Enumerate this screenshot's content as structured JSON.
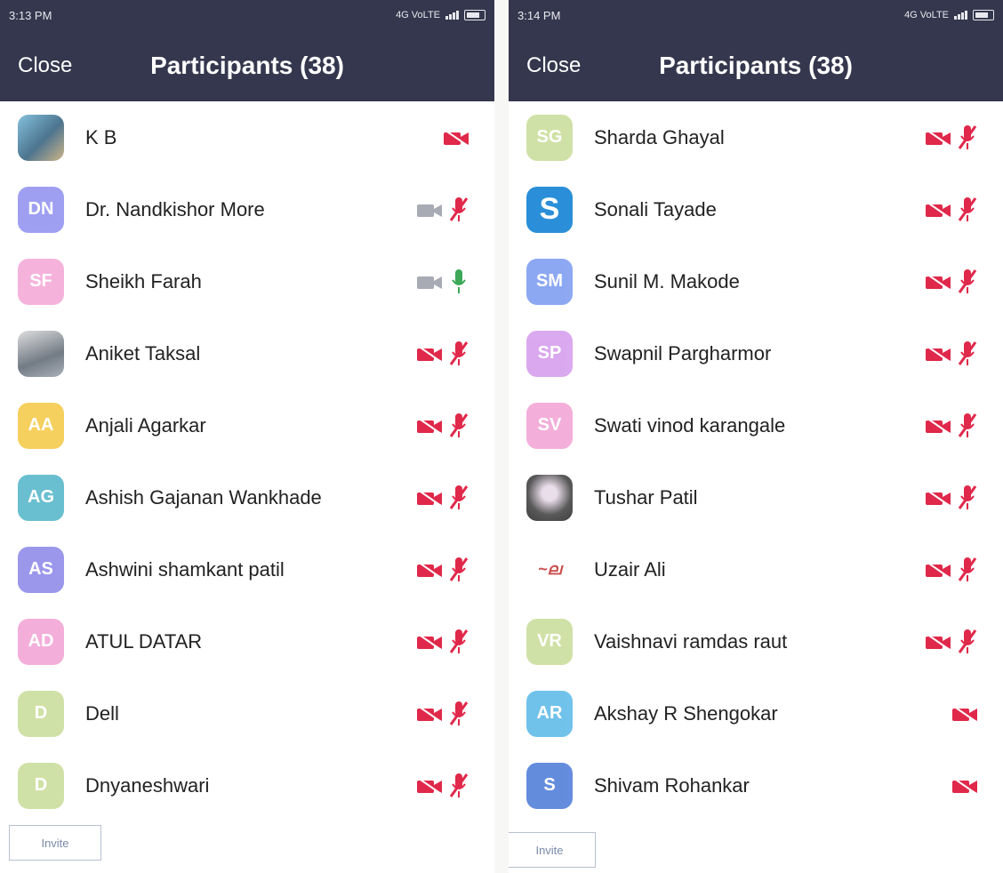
{
  "screens": [
    {
      "status_time": "3:13 PM",
      "status_network": "4G VoLTE",
      "close_label": "Close",
      "title": "Participants (38)",
      "invite_label": "Invite",
      "participants": [
        {
          "name": "K B",
          "initials": "",
          "avatar": "photo",
          "color": "#5a8fc4",
          "video": "off",
          "mic": "none"
        },
        {
          "name": "Dr. Nandkishor More",
          "initials": "DN",
          "avatar": "initials",
          "color": "#8f8ff0",
          "video": "on",
          "mic": "muted"
        },
        {
          "name": "Sheikh Farah",
          "initials": "SF",
          "avatar": "initials",
          "color": "#f4a6d6",
          "video": "on",
          "mic": "active"
        },
        {
          "name": "Aniket Taksal",
          "initials": "",
          "avatar": "photo2",
          "color": "#7a8290",
          "video": "off",
          "mic": "muted"
        },
        {
          "name": "Anjali Agarkar",
          "initials": "AA",
          "avatar": "initials",
          "color": "#f5c842",
          "video": "off",
          "mic": "muted"
        },
        {
          "name": "Ashish Gajanan Wankhade",
          "initials": "AG",
          "avatar": "initials",
          "color": "#4fb4c8",
          "video": "off",
          "mic": "muted"
        },
        {
          "name": "Ashwini shamkant patil",
          "initials": "AS",
          "avatar": "initials",
          "color": "#8a86e8",
          "video": "off",
          "mic": "muted"
        },
        {
          "name": "ATUL DATAR",
          "initials": "AD",
          "avatar": "initials",
          "color": "#f2a0d4",
          "video": "off",
          "mic": "muted"
        },
        {
          "name": "Dell",
          "initials": "D",
          "avatar": "initials",
          "color": "#c8dc98",
          "video": "off",
          "mic": "muted"
        },
        {
          "name": "Dnyaneshwari",
          "initials": "D",
          "avatar": "initials",
          "color": "#c8dc98",
          "video": "off",
          "mic": "muted"
        }
      ]
    },
    {
      "status_time": "3:14 PM",
      "status_network": "4G VoLTE",
      "close_label": "Close",
      "title": "Participants (38)",
      "invite_label": "Invite",
      "participants": [
        {
          "name": "Sharda Ghayal",
          "initials": "SG",
          "avatar": "initials",
          "color": "#c8dc98",
          "video": "off",
          "mic": "muted"
        },
        {
          "name": "Sonali Tayade",
          "initials": "S",
          "avatar": "blue-s",
          "color": "#2a8fd8",
          "video": "off",
          "mic": "muted"
        },
        {
          "name": "Sunil M. Makode",
          "initials": "SM",
          "avatar": "initials",
          "color": "#7a9af0",
          "video": "off",
          "mic": "muted"
        },
        {
          "name": "Swapnil Pargharmor",
          "initials": "SP",
          "avatar": "initials",
          "color": "#d49aec",
          "video": "off",
          "mic": "muted"
        },
        {
          "name": "Swati vinod karangale",
          "initials": "SV",
          "avatar": "initials",
          "color": "#f2a0d4",
          "video": "off",
          "mic": "muted"
        },
        {
          "name": "Tushar Patil",
          "initials": "",
          "avatar": "photo3",
          "color": "#3c3c3c",
          "video": "off",
          "mic": "muted"
        },
        {
          "name": "Uzair Ali",
          "initials": "",
          "avatar": "sign",
          "color": "#c0302c",
          "video": "off",
          "mic": "muted"
        },
        {
          "name": "Vaishnavi ramdas raut",
          "initials": "VR",
          "avatar": "initials",
          "color": "#c8dc98",
          "video": "off",
          "mic": "muted"
        },
        {
          "name": "Akshay R Shengokar",
          "initials": "AR",
          "avatar": "initials",
          "color": "#58b8e8",
          "video": "off",
          "mic": "none"
        },
        {
          "name": "Shivam Rohankar",
          "initials": "S",
          "avatar": "initials",
          "color": "#4a78d8",
          "video": "off",
          "mic": "none"
        }
      ]
    }
  ],
  "colors": {
    "header_bg": "#34374d",
    "muted_red": "#e0284a",
    "video_on_gray": "#a8aab4",
    "mic_active_green": "#3ca858",
    "mic_idle_gray": "#b4b4b4"
  }
}
